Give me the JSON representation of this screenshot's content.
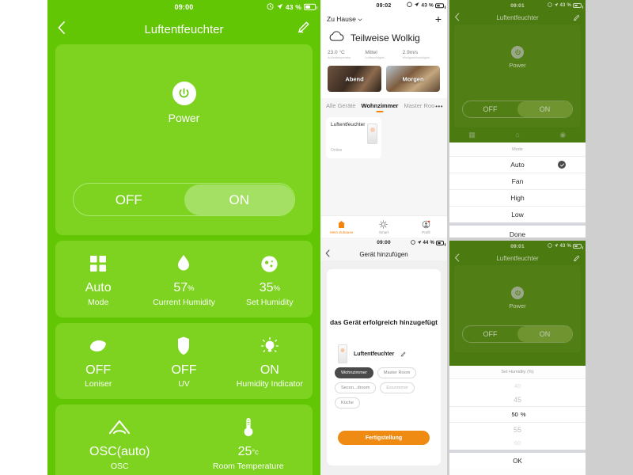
{
  "panel1": {
    "status": {
      "clock": "09:00",
      "battery_pct": "43 %",
      "alarm_icon": "alarm-icon",
      "location_icon": "location-arrow-icon"
    },
    "nav": {
      "back_icon": "chevron-left-icon",
      "title": "Luftentfeuchter",
      "edit_icon": "pencil-icon"
    },
    "power": {
      "icon": "power-icon",
      "label": "Power",
      "off_label": "OFF",
      "on_label": "ON",
      "state": "ON"
    },
    "grid": [
      {
        "icon": "grid-squares-icon",
        "value": "Auto",
        "unit": "",
        "label": "Mode"
      },
      {
        "icon": "water-drop-icon",
        "value": "57",
        "unit": "%",
        "label": "Current Humidity"
      },
      {
        "icon": "humidity-circle-icon",
        "value": "35",
        "unit": "%",
        "label": "Set Humidity"
      },
      {
        "icon": "ionizer-leaf-icon",
        "value": "OFF",
        "unit": "",
        "label": "Loniser"
      },
      {
        "icon": "uv-shield-icon",
        "value": "OFF",
        "unit": "",
        "label": "UV"
      },
      {
        "icon": "bulb-icon",
        "value": "ON",
        "unit": "",
        "label": "Humidity Indicator"
      },
      {
        "icon": "osc-arc-icon",
        "value": "OSC(auto)",
        "unit": "",
        "label": "OSC"
      },
      {
        "icon": "thermometer-icon",
        "value": "25",
        "unit": "°c",
        "label": "Room Temperature"
      }
    ]
  },
  "panel2": {
    "status": {
      "clock": "09:02",
      "battery_pct": "43 %"
    },
    "header": {
      "home_name": "Zu Hause",
      "chevron_icon": "chevron-down-icon",
      "add_icon": "plus-icon"
    },
    "weather": {
      "icon": "cloud-icon",
      "description": "Teilweise Wolkig",
      "stats": [
        {
          "value": "23.0 °C",
          "label": "Außentemperatur"
        },
        {
          "value": "Mittel",
          "label": "Luftfeuchtigkei..."
        },
        {
          "value": "2.9m/s",
          "label": "Windgeschwindigkei..."
        }
      ]
    },
    "scenes": [
      {
        "label": "Abend"
      },
      {
        "label": "Morgen"
      }
    ],
    "room_tabs": [
      {
        "label": "Alle Geräte",
        "active": false
      },
      {
        "label": "Wohnzimmer",
        "active": true
      },
      {
        "label": "Master Roo",
        "active": false
      }
    ],
    "more_icon": "ellipsis-icon",
    "device": {
      "name": "Luftentfeuchter",
      "status": "Online",
      "image_icon": "dehumidifier-icon"
    },
    "tabbar": [
      {
        "icon": "home-icon",
        "label": "Mein Zuhause",
        "active": true
      },
      {
        "icon": "smart-sun-icon",
        "label": "Smart",
        "active": false
      },
      {
        "icon": "profile-icon",
        "label": "Profil",
        "active": false
      }
    ]
  },
  "panel3": {
    "status": {
      "clock": "09:00",
      "battery_pct": "44 %"
    },
    "nav": {
      "back_icon": "chevron-left-icon",
      "title": "Gerät hinzufügen"
    },
    "success_text": "das Gerät erfolgreich hinzugefügt",
    "device": {
      "name": "Luftentfeuchter",
      "edit_icon": "pencil-icon",
      "image_icon": "dehumidifier-icon"
    },
    "rooms": [
      {
        "label": "Wohnzimmer",
        "selected": true
      },
      {
        "label": "Master Room",
        "selected": false
      },
      {
        "label": "Secon...droom",
        "selected": false
      },
      {
        "label": "Esszimmer",
        "selected": false
      },
      {
        "label": "Küche",
        "selected": false
      }
    ],
    "cta_label": "Fertigstellung"
  },
  "panel4": {
    "status": {
      "clock": "09:01",
      "battery_pct": "43 %"
    },
    "nav": {
      "back_icon": "chevron-left-icon",
      "title": "Luftentfeuchter",
      "edit_icon": "pencil-icon"
    },
    "power": {
      "icon": "power-icon",
      "label": "Power",
      "off_label": "OFF",
      "on_label": "ON",
      "state": "ON"
    },
    "picker": {
      "title": "Mode",
      "options": [
        {
          "label": "Auto",
          "selected": true
        },
        {
          "label": "Fan",
          "selected": false
        },
        {
          "label": "High",
          "selected": false
        },
        {
          "label": "Low",
          "selected": false
        }
      ],
      "confirm_label": "Done",
      "check_icon": "check-circle-icon"
    }
  },
  "panel5": {
    "status": {
      "clock": "09:01",
      "battery_pct": "43 %"
    },
    "nav": {
      "back_icon": "chevron-left-icon",
      "title": "Luftentfeuchter",
      "edit_icon": "pencil-icon"
    },
    "power": {
      "icon": "power-icon",
      "label": "Power",
      "off_label": "OFF",
      "on_label": "ON",
      "state": "ON"
    },
    "picker": {
      "title": "Set Humidity (%)",
      "values": [
        "40",
        "45",
        "50",
        "55",
        "60"
      ],
      "selected_value": "50",
      "unit": "%",
      "confirm_label": "OK"
    }
  },
  "colors": {
    "green_bg": "#63c605",
    "green_card": "#7ed321",
    "green_toggle_on": "#a4e063",
    "dim_green_bg": "#4b7a10",
    "orange": "#ef8b12"
  }
}
